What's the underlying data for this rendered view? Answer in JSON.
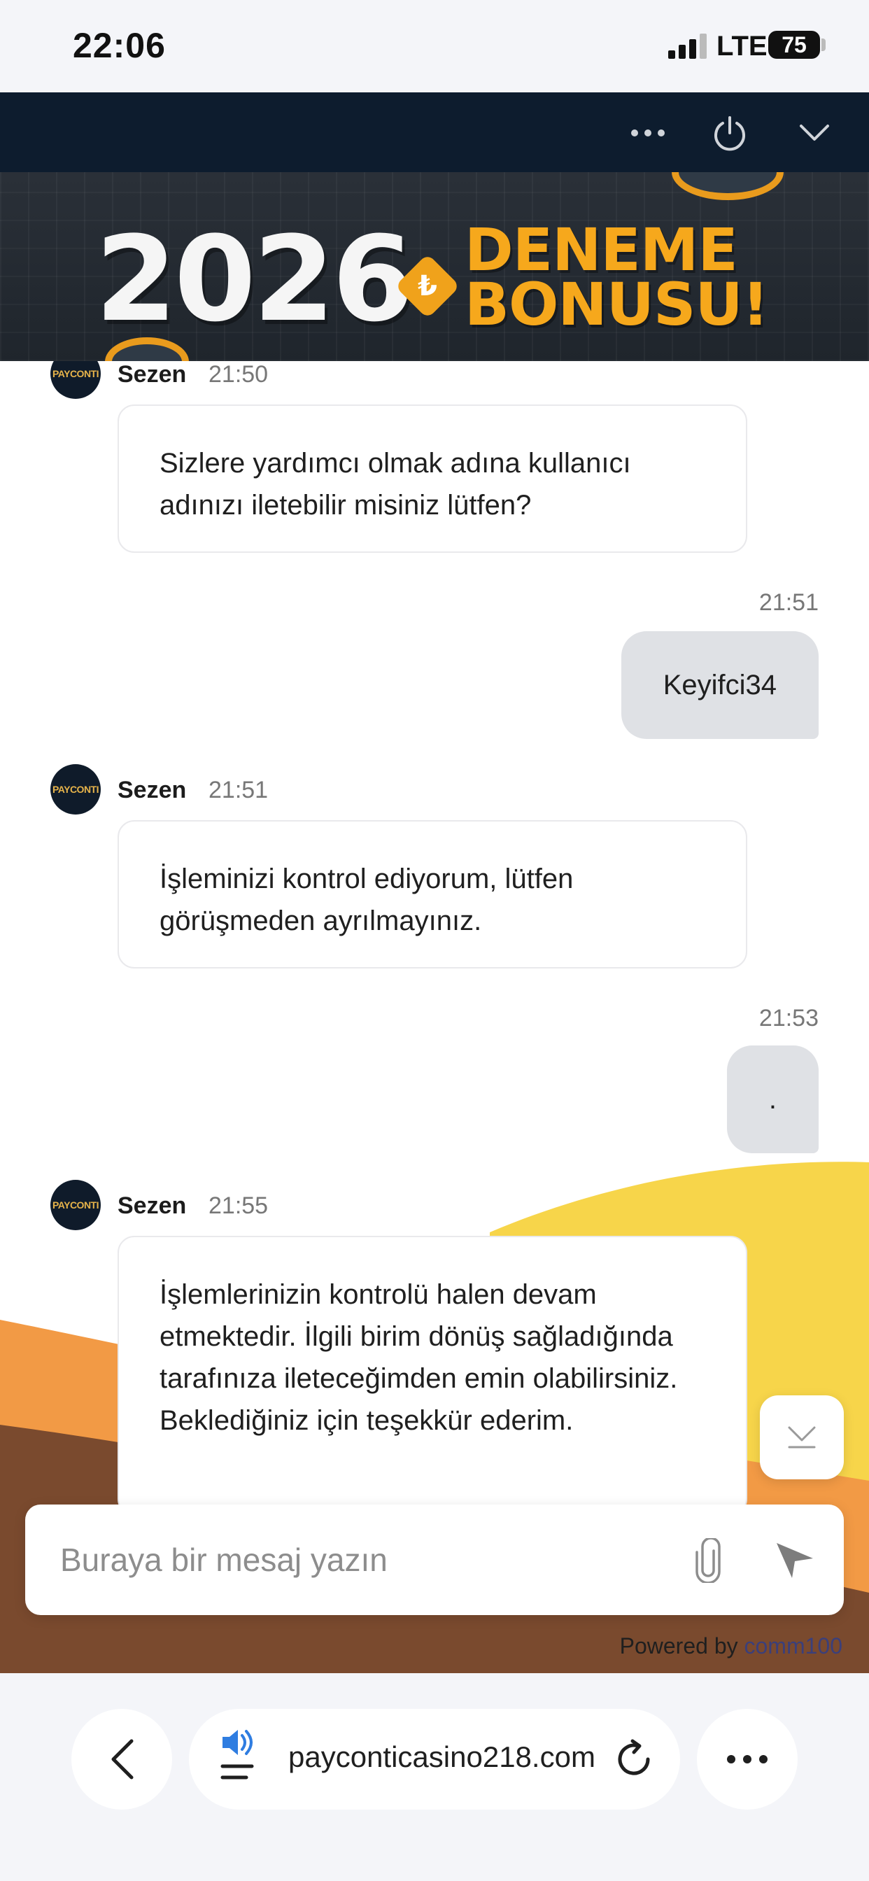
{
  "status_bar": {
    "time": "22:06",
    "network": "LTE",
    "battery": "75"
  },
  "banner": {
    "year": "2026",
    "currency_symbol": "₺",
    "line1": "DENEME",
    "line2": "BONUSU!"
  },
  "messages": [
    {
      "sender": "Sezen",
      "time": "21:50",
      "text": "Sizlere yardımcı olmak adına kullanıcı adınızı iletebilir misiniz lütfen?"
    },
    {
      "time": "21:51",
      "text": "Keyifci34"
    },
    {
      "sender": "Sezen",
      "time": "21:51",
      "text": "İşleminizi kontrol ediyorum, lütfen görüşmeden ayrılmayınız."
    },
    {
      "time": "21:53",
      "text": "."
    },
    {
      "sender": "Sezen",
      "time": "21:55",
      "text": "İşlemlerinizin kontrolü halen devam etmektedir. İlgili birim dönüş sağladığında tarafınıza ileteceğimden emin olabilirsiniz. Beklediğiniz için teşekkür ederim."
    }
  ],
  "avatar_label": "PAYCONTI",
  "composer": {
    "placeholder": "Buraya bir mesaj yazın"
  },
  "powered_by": {
    "prefix": "Powered by",
    "brand": "comm100"
  },
  "browser": {
    "url": "payconticasino218.com"
  },
  "colors": {
    "header_bg": "#0d1c2e",
    "banner_accent": "#f6a81c",
    "user_bubble": "#dfe1e5",
    "deco_yellow": "#f7d54a",
    "deco_orange": "#f29a45",
    "deco_brown": "#7a4a2e"
  }
}
